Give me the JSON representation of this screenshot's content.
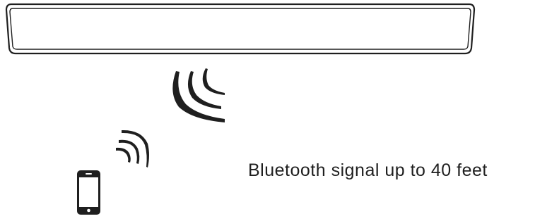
{
  "caption": "Bluetooth signal up to 40 feet",
  "colors": {
    "line": "#1f1f1f",
    "device_fill": "#ffffff",
    "phone_screen": "#ffffff"
  },
  "icons": {
    "soundbar": "soundbar-icon",
    "soundbar_waves": "signal-waves-icon",
    "phone_waves": "signal-waves-icon",
    "phone": "smartphone-icon"
  }
}
